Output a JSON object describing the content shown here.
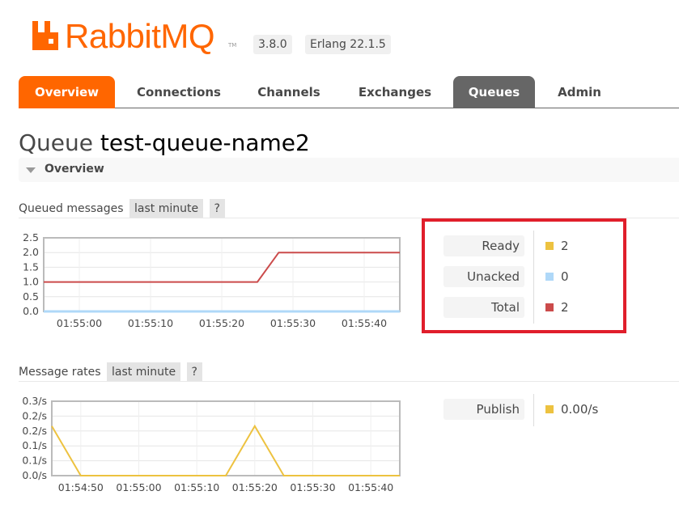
{
  "app": {
    "logo_text": "RabbitMQ",
    "logo_tm": "TM",
    "version": "3.8.0",
    "erlang": "Erlang 22.1.5",
    "brand_color": "#ff6600"
  },
  "nav": {
    "tabs": [
      {
        "label": "Overview",
        "state": "active-orange"
      },
      {
        "label": "Connections"
      },
      {
        "label": "Channels"
      },
      {
        "label": "Exchanges"
      },
      {
        "label": "Queues",
        "state": "selected"
      },
      {
        "label": "Admin"
      }
    ]
  },
  "page": {
    "title_prefix": "Queue",
    "queue_name": "test-queue-name2"
  },
  "overview_section": {
    "label": "Overview"
  },
  "queued_messages": {
    "heading": "Queued messages",
    "range": "last minute",
    "help": "?",
    "legend": [
      {
        "label": "Ready",
        "value": "2",
        "color": "#edc240"
      },
      {
        "label": "Unacked",
        "value": "0",
        "color": "#afd8f8"
      },
      {
        "label": "Total",
        "value": "2",
        "color": "#cb4b4b"
      }
    ]
  },
  "message_rates": {
    "heading": "Message rates",
    "range": "last minute",
    "help": "?",
    "legend": [
      {
        "label": "Publish",
        "value": "0.00/s",
        "color": "#edc240"
      }
    ]
  },
  "chart_data": [
    {
      "type": "line",
      "title": "Queued messages",
      "x": [
        "01:54:55",
        "01:55:00",
        "01:55:05",
        "01:55:10",
        "01:55:15",
        "01:55:20",
        "01:55:25",
        "01:55:28",
        "01:55:30",
        "01:55:35",
        "01:55:40",
        "01:55:45"
      ],
      "x_tick_labels": [
        "01:55:00",
        "01:55:10",
        "01:55:20",
        "01:55:30",
        "01:55:40"
      ],
      "y_tick_labels": [
        "0.0",
        "0.5",
        "1.0",
        "1.5",
        "2.0",
        "2.5"
      ],
      "ylim": [
        0,
        2.5
      ],
      "grid": true,
      "series": [
        {
          "name": "Total",
          "color": "#cb4b4b",
          "values": [
            1,
            1,
            1,
            1,
            1,
            1,
            1,
            2,
            2,
            2,
            2,
            2
          ]
        },
        {
          "name": "Unacked",
          "color": "#afd8f8",
          "values": [
            0,
            0,
            0,
            0,
            0,
            0,
            0,
            0,
            0,
            0,
            0,
            0
          ]
        }
      ]
    },
    {
      "type": "line",
      "title": "Message rates",
      "x": [
        "01:54:45",
        "01:54:50",
        "01:55:00",
        "01:55:10",
        "01:55:15",
        "01:55:20",
        "01:55:25",
        "01:55:30",
        "01:55:40",
        "01:55:45"
      ],
      "x_tick_labels": [
        "01:54:50",
        "01:55:00",
        "01:55:10",
        "01:55:20",
        "01:55:30",
        "01:55:40"
      ],
      "y_tick_labels": [
        "0.0/s",
        "0.1/s",
        "0.1/s",
        "0.2/s",
        "0.2/s",
        "0.3/s"
      ],
      "ylim": [
        0,
        0.3
      ],
      "grid": true,
      "series": [
        {
          "name": "Publish",
          "color": "#edc240",
          "values": [
            0.2,
            0,
            0,
            0,
            0,
            0.2,
            0,
            0,
            0,
            0
          ]
        }
      ]
    }
  ]
}
